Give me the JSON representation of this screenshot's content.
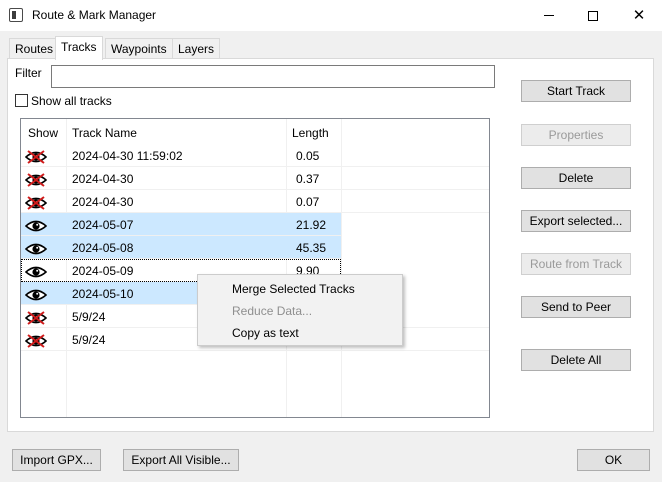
{
  "window": {
    "title": "Route & Mark Manager"
  },
  "tabs": [
    {
      "label": "Routes"
    },
    {
      "label": "Tracks"
    },
    {
      "label": "Waypoints"
    },
    {
      "label": "Layers"
    }
  ],
  "filter": {
    "label": "Filter",
    "value": ""
  },
  "show_all": {
    "label": "Show all tracks",
    "checked": false
  },
  "table": {
    "columns": [
      "Show",
      "Track Name",
      "Length"
    ],
    "rows": [
      {
        "name": "2024-04-30 11:59:02",
        "length": "0.05",
        "visible": false,
        "selected": false
      },
      {
        "name": "2024-04-30",
        "length": "0.37",
        "visible": false,
        "selected": false
      },
      {
        "name": "2024-04-30",
        "length": "0.07",
        "visible": false,
        "selected": false
      },
      {
        "name": "2024-05-07",
        "length": "21.92",
        "visible": true,
        "selected": true
      },
      {
        "name": "2024-05-08",
        "length": "45.35",
        "visible": true,
        "selected": true
      },
      {
        "name": "2024-05-09",
        "length": "9.90",
        "visible": true,
        "selected": false
      },
      {
        "name": "2024-05-10",
        "length": "",
        "visible": true,
        "selected": true
      },
      {
        "name": "5/9/24",
        "length": "",
        "visible": false,
        "selected": false
      },
      {
        "name": "5/9/24",
        "length": "",
        "visible": false,
        "selected": false
      }
    ]
  },
  "buttons": {
    "start_track": "Start Track",
    "properties": "Properties",
    "delete": "Delete",
    "export_selected": "Export selected...",
    "route_from_track": "Route from Track",
    "send_to_peer": "Send to Peer",
    "delete_all": "Delete All",
    "import_gpx": "Import GPX...",
    "export_all_visible": "Export All Visible...",
    "ok": "OK"
  },
  "context_menu": {
    "merge": "Merge Selected Tracks",
    "reduce": "Reduce Data...",
    "copy": "Copy as text"
  },
  "colors": {
    "selection": "#cce8ff",
    "eye_hidden_cross": "#d11a1a"
  }
}
